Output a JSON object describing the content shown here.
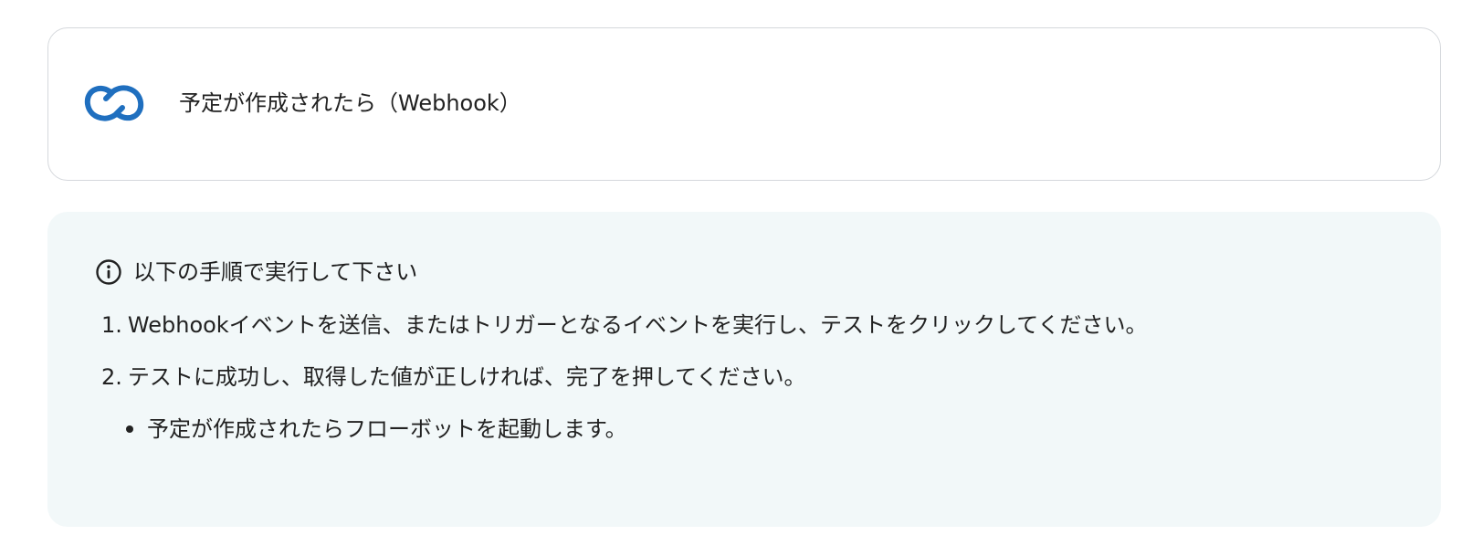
{
  "trigger": {
    "title": "予定が作成されたら（Webhook）",
    "icon": "linked-rings-icon",
    "accent_color": "#1f6fbf"
  },
  "instructions": {
    "icon": "info-icon",
    "heading": "以下の手順で実行して下さい",
    "steps": [
      {
        "number": "1.",
        "text": "Webhookイベントを送信、またはトリガーとなるイベントを実行し、テストをクリックしてください。"
      },
      {
        "number": "2.",
        "text": "テストに成功し、取得した値が正しければ、完了を押してください。"
      }
    ],
    "bullets": [
      "予定が作成されたらフローボットを起動します。"
    ],
    "background_color": "#f2f8f9"
  }
}
